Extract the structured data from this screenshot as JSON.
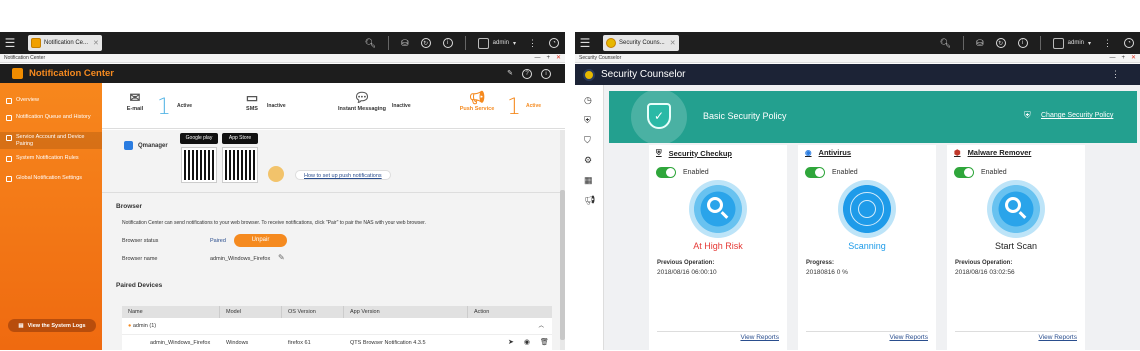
{
  "left": {
    "taskbar": {
      "tab_label": "Notification Ce...",
      "user": "admin"
    },
    "window_label": "Notification Center",
    "app_title": "Notification Center",
    "sidebar": {
      "items": [
        {
          "label": "Overview"
        },
        {
          "label": "Notification Queue and History"
        },
        {
          "label": "Service Account and Device Pairing"
        },
        {
          "label": "System Notification Rules"
        },
        {
          "label": "Global Notification Settings"
        }
      ],
      "view_logs": "View the System Logs"
    },
    "channels": [
      {
        "name": "E-mail",
        "count": "1",
        "status": "Active"
      },
      {
        "name": "SMS",
        "count": "",
        "status": "Inactive"
      },
      {
        "name": "Instant Messaging",
        "count": "",
        "status": "Inactive"
      },
      {
        "name": "Push Service",
        "count": "1",
        "status": "Active"
      }
    ],
    "qmanager": {
      "label": "Qmanager",
      "google_play": "Google play",
      "app_store": "App Store",
      "setup_link": "How to set up push notifications"
    },
    "browser": {
      "heading": "Browser",
      "description": "Notification Center can send notifications to your web browser. To receive notifications, click \"Pair\" to pair the NAS with your web browser.",
      "status_label": "Browser status",
      "status_value": "Paired",
      "unpair_button": "Unpair",
      "name_label": "Browser name",
      "name_value": "admin_Windows_Firefox"
    },
    "paired": {
      "heading": "Paired Devices",
      "columns": [
        "Name",
        "Model",
        "OS Version",
        "App Version",
        "Action"
      ],
      "group": "admin (1)",
      "row": {
        "name": "admin_Windows_Firefox",
        "model": "Windows",
        "os": "firefox 61",
        "app": "QTS Browser Notification 4.3.5"
      }
    }
  },
  "right": {
    "taskbar": {
      "tab_label": "Security Couns...",
      "user": "admin"
    },
    "window_label": "Security Counselor",
    "app_title": "Security Counselor",
    "banner": {
      "policy": "Basic Security Policy",
      "change_link": "Change Security Policy"
    },
    "cards": [
      {
        "title": "Security Checkup",
        "toggle": "Enabled",
        "status": "At High Risk",
        "status_color": "#e53935",
        "info_label": "Previous Operation:",
        "info_value": "2018/08/16 06:00:10",
        "report": "View Reports"
      },
      {
        "title": "Antivirus",
        "toggle": "Enabled",
        "status": "Scanning",
        "status_color": "#1e9be9",
        "info_label": "Progress:",
        "info_value": "20180816 0 %",
        "report": "View Reports"
      },
      {
        "title": "Malware Remover",
        "toggle": "Enabled",
        "status": "Start Scan",
        "status_color": "#222222",
        "info_label": "Previous Operation:",
        "info_value": "2018/08/16 03:02:56",
        "report": "View Reports"
      }
    ]
  },
  "colors": {
    "orange": "#f58a1f",
    "teal": "#23a08f",
    "navy": "#1c2336"
  }
}
